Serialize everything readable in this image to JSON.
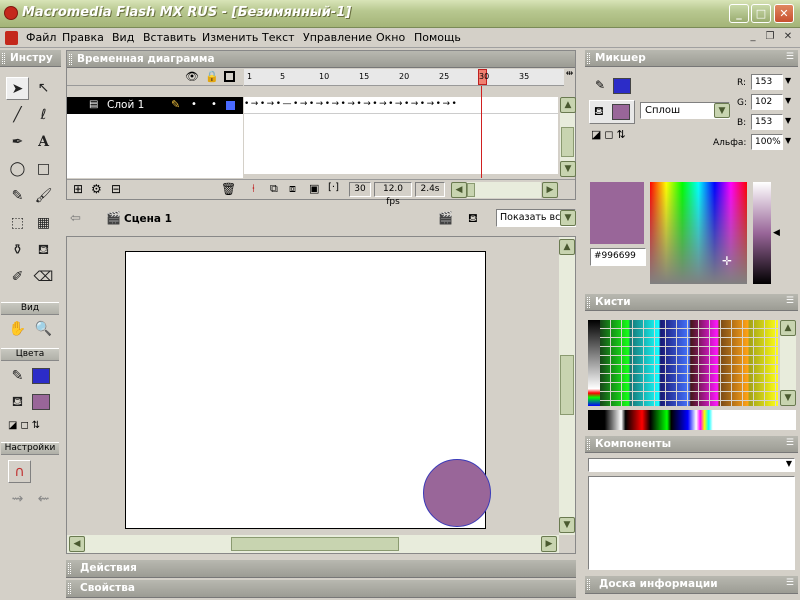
{
  "window": {
    "title": "Macromedia Flash MX RUS - [Безимянный-1]",
    "buttons": {
      "minimize": "_",
      "maximize": "□",
      "close": "✕"
    }
  },
  "menu": [
    "Файл",
    "Правка",
    "Вид",
    "Вставить",
    "Изменить",
    "Текст",
    "Управление",
    "Окно",
    "Помощь"
  ],
  "mdi": {
    "minimize": "_",
    "restore": "❐",
    "close": "✕"
  },
  "tools_panel": {
    "title": "Инстру",
    "view_label": "Вид",
    "colors_label": "Цвета",
    "options_label": "Настройки",
    "stroke_color": "#2c2cc8",
    "fill_color": "#996699"
  },
  "timeline": {
    "title": "Временная диаграмма",
    "layer_name": "Слой 1",
    "frame_ticks": [
      "1",
      "5",
      "10",
      "15",
      "20",
      "25",
      "30",
      "35"
    ],
    "current_frame": "30",
    "frame_rate": "12.0 fps",
    "elapsed": "2.4s"
  },
  "scene_bar": {
    "scene_name": "Сцена 1",
    "zoom": "Показать все"
  },
  "stage": {
    "circle_color": "#996699"
  },
  "bottom_panels": {
    "actions": "Действия",
    "properties": "Свойства"
  },
  "mixer": {
    "title": "Микшер",
    "fill_style": "Сплош",
    "r_label": "R:",
    "r": "153",
    "g_label": "G:",
    "g": "102",
    "b_label": "B:",
    "b": "153",
    "alpha_label": "Альфа:",
    "alpha": "100%",
    "hex": "#996699",
    "stroke_color": "#2c2cc8",
    "fill_color": "#996699"
  },
  "swatches": {
    "title": "Кисти"
  },
  "components": {
    "title": "Компоненты"
  },
  "reference": {
    "title": "Доска информации"
  }
}
